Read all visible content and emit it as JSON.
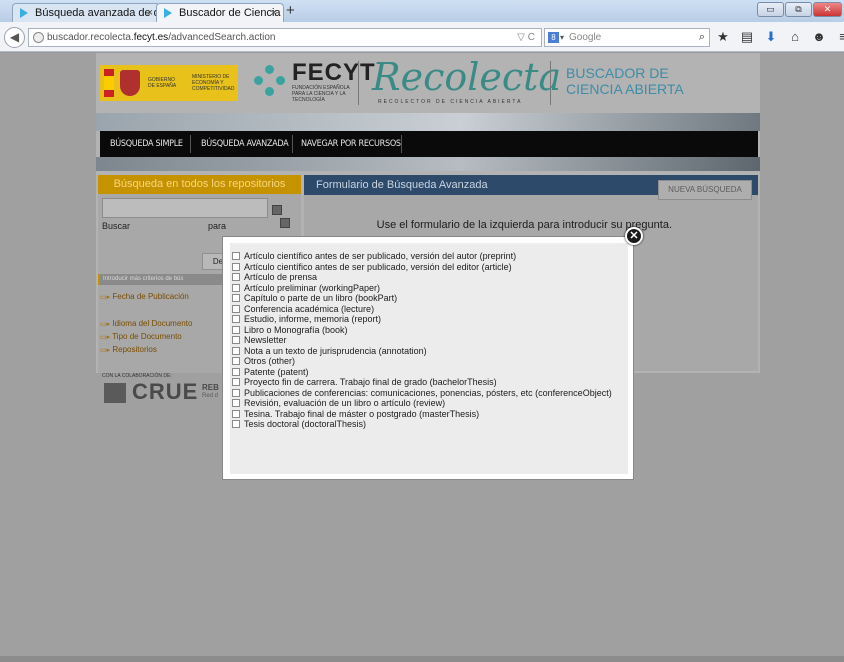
{
  "browser": {
    "tabs": [
      {
        "label": "Búsqueda avanzada de doc..."
      },
      {
        "label": "Buscador de Ciencia Abiert..."
      }
    ],
    "tab_close": "×",
    "new_tab": "+",
    "window_buttons": {
      "minimize": "▭",
      "maximize": "⧉",
      "close": "✕"
    },
    "back": "◀",
    "url_prefix": "buscador.recolecta.",
    "url_domain": "fecyt.es",
    "url_suffix": "/advancedSearch.action",
    "url_tools": "▽ C",
    "search_engine_label": "8",
    "search_engine_arrow": "▾",
    "search_placeholder": "Google",
    "search_icon": "⌕",
    "toolbar_icons": [
      "★",
      "▤",
      "⬇",
      "⌂",
      "☻",
      "≡"
    ]
  },
  "header": {
    "gov_text_1": "GOBIERNO DE ESPAÑA",
    "gov_text_2": "MINISTERIO DE ECONOMÍA Y COMPETITIVIDAD",
    "fecyt_name": "FECYT",
    "fecyt_sub": "FUNDACIÓN ESPAÑOLA PARA LA CIENCIA Y LA TECNOLOGÍA",
    "recolecta": "Recolecta",
    "recolecta_sub": "RECOLECTOR DE CIENCIA ABIERTA",
    "buscador_line1": "BUSCADOR DE",
    "buscador_line2": "CIENCIA ABIERTA"
  },
  "menu": {
    "items": [
      "BÚSQUEDA SIMPLE",
      "BÚSQUEDA AVANZADA",
      "NAVEGAR POR RECURSOS"
    ]
  },
  "left": {
    "heading": "Búsqueda en todos los repositorios",
    "buscar": "Buscar",
    "para": "para",
    "deshacer": "Deshacer",
    "criteria": "Introducir más criterios de bús",
    "arrow": "▭▸",
    "facets": [
      "Fecha de Publicación",
      "Idioma del Documento",
      "Tipo de Documento",
      "Repositorios"
    ],
    "colab": "CON LA COLABORACIÓN DE:",
    "crue": "CRUE",
    "rebi": "REB",
    "rebi_sub": "Red d"
  },
  "right": {
    "heading": "Formulario de Búsqueda Avanzada",
    "new_search": "NUEVA BÚSQUEDA",
    "hint": "Use el formulario de la izquierda para introducir su pregunta."
  },
  "modal": {
    "close": "✕",
    "options": [
      "Artículo científico antes de ser publicado, versión del autor (preprint)",
      "Artículo científico antes de ser publicado, versión del editor (article)",
      "Artículo de prensa",
      "Artículo preliminar (workingPaper)",
      "Capítulo o parte de un libro (bookPart)",
      "Conferencia académica (lecture)",
      "Estudio, informe, memoria (report)",
      "Libro o Monografía (book)",
      "Newsletter",
      "Nota a un texto de jurisprudencia (annotation)",
      "Otros (other)",
      "Patente (patent)",
      "Proyecto fin de carrera. Trabajo final de grado (bachelorThesis)",
      "Publicaciones de conferencias: comunicaciones, ponencias, pósters, etc (conferenceObject)",
      "Revisión, evaluación de un libro o artículo (review)",
      "Tesina. Trabajo final de máster o postgrado (masterThesis)",
      "Tesis doctoral (doctoralThesis)"
    ]
  },
  "colors": {
    "accent_gold": "#c69300",
    "header_navy": "#2d4a6b",
    "brand_teal": "#3a8a86",
    "overlay_gray": "#a0a0a0"
  }
}
